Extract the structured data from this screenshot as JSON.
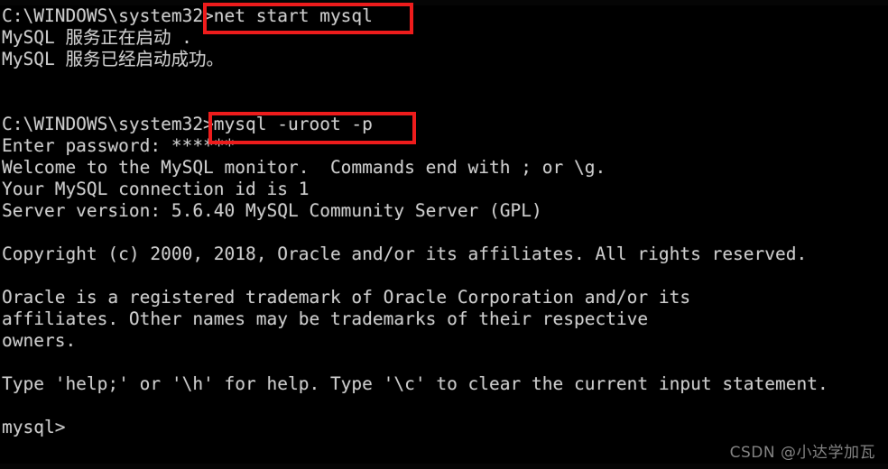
{
  "window": {
    "app": "Windows Command Prompt",
    "background_color": "#000000",
    "foreground_color": "#cccccc",
    "highlight_color": "#ee1c1c"
  },
  "terminal": {
    "lines": [
      {
        "id": "prompt-net-start",
        "text": "C:\\WINDOWS\\system32>net start mysql"
      },
      {
        "id": "service-starting",
        "text": "MySQL 服务正在启动 ."
      },
      {
        "id": "service-started",
        "text": "MySQL 服务已经启动成功。"
      },
      {
        "id": "blank-1",
        "text": ""
      },
      {
        "id": "blank-2",
        "text": ""
      },
      {
        "id": "prompt-mysql-login",
        "text": "C:\\WINDOWS\\system32>mysql -uroot -p"
      },
      {
        "id": "enter-password",
        "text": "Enter password: ******"
      },
      {
        "id": "welcome",
        "text": "Welcome to the MySQL monitor.  Commands end with ; or \\g."
      },
      {
        "id": "connection-id",
        "text": "Your MySQL connection id is 1"
      },
      {
        "id": "server-version",
        "text": "Server version: 5.6.40 MySQL Community Server (GPL)"
      },
      {
        "id": "blank-3",
        "text": ""
      },
      {
        "id": "copyright",
        "text": "Copyright (c) 2000, 2018, Oracle and/or its affiliates. All rights reserved."
      },
      {
        "id": "blank-4",
        "text": ""
      },
      {
        "id": "trademark-1",
        "text": "Oracle is a registered trademark of Oracle Corporation and/or its"
      },
      {
        "id": "trademark-2",
        "text": "affiliates. Other names may be trademarks of their respective"
      },
      {
        "id": "trademark-3",
        "text": "owners."
      },
      {
        "id": "blank-5",
        "text": ""
      },
      {
        "id": "help-hint",
        "text": "Type 'help;' or '\\h' for help. Type '\\c' to clear the current input statement."
      },
      {
        "id": "blank-6",
        "text": ""
      },
      {
        "id": "mysql-prompt",
        "text": "mysql>"
      }
    ]
  },
  "annotations": {
    "box_net_start": {
      "label": "net start mysql",
      "color": "#ee1c1c"
    },
    "box_mysql_login": {
      "label": "mysql -uroot -p",
      "color": "#ee1c1c"
    }
  },
  "watermark": {
    "text": "CSDN @小达学加瓦"
  }
}
